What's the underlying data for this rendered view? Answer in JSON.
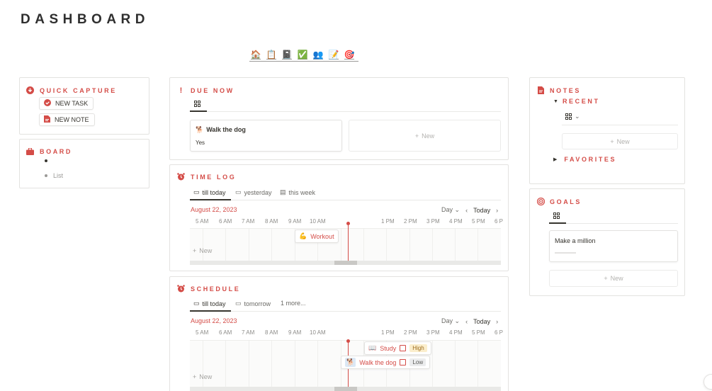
{
  "page": {
    "title": "DASHBOARD"
  },
  "iconbar": {
    "icons": [
      "🏠",
      "📋",
      "📓",
      "✅",
      "👥",
      "📝",
      "🎯"
    ]
  },
  "quick_capture": {
    "title": "QUICK CAPTURE",
    "new_task": "NEW TASK",
    "new_note": "NEW NOTE"
  },
  "board": {
    "title": "BOARD",
    "item2": "List"
  },
  "due_now": {
    "title": "DUE NOW",
    "card_title": "Walk the dog",
    "card_prop": "Yes",
    "new_label": "New"
  },
  "time_log": {
    "title": "TIME LOG",
    "tabs": [
      "till today",
      "yesterday",
      "this week"
    ],
    "date": "August 22, 2023",
    "view": "Day",
    "today": "Today",
    "hours": [
      "5 AM",
      "6 AM",
      "7 AM",
      "8 AM",
      "9 AM",
      "10 AM",
      "1 PM",
      "2 PM",
      "3 PM",
      "4 PM",
      "5 PM",
      "6 P"
    ],
    "event": "Workout",
    "new_label": "New"
  },
  "schedule": {
    "title": "SCHEDULE",
    "tabs": [
      "till today",
      "tomorrow",
      "1 more..."
    ],
    "date": "August 22, 2023",
    "view": "Day",
    "today": "Today",
    "hours": [
      "5 AM",
      "6 AM",
      "7 AM",
      "8 AM",
      "9 AM",
      "10 AM",
      "1 PM",
      "2 PM",
      "3 PM",
      "4 PM",
      "5 PM",
      "6 P"
    ],
    "event1": {
      "label": "Study",
      "tag": "High"
    },
    "event2": {
      "label": "Walk the dog",
      "tag": "Low"
    },
    "new_label": "New"
  },
  "notes": {
    "title": "NOTES",
    "recent": "RECENT",
    "favorites": "FAVORITES",
    "new_label": "New"
  },
  "goals": {
    "title": "GOALS",
    "card_title": "Make a million",
    "new_label": "New"
  },
  "colors": {
    "accent": "#d44c47",
    "text": "#37352f",
    "muted": "#9b9a97",
    "border": "#e3e2e0"
  }
}
